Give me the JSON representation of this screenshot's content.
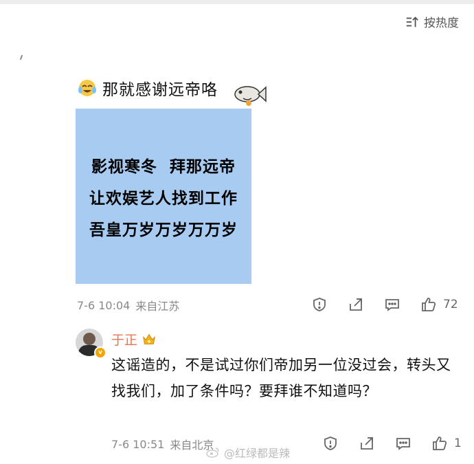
{
  "sort": {
    "label": "按热度",
    "icon": "sort-icon"
  },
  "comment": {
    "caption": "那就感谢远帝咯",
    "caption_emoji": "crying-laugh-emoji",
    "sticker": "fish-sticker",
    "meme_lines": [
      "影视寒冬  拜那远帝",
      "让欢娱艺人找到工作",
      "吾皇万岁万岁万万岁"
    ],
    "meme_bg": "#a7cbf1",
    "timestamp": "7-6 10:04",
    "location": "来自江苏",
    "likes": "72"
  },
  "reply": {
    "username": "于正",
    "name_color": "#eb7350",
    "badge": "crown-icon",
    "verified_badge": "v",
    "text": "这谣造的，不是试过你们帝加另一位没过会，转头又找我们，加了条件吗？要拜谁不知道吗？",
    "timestamp": "7-6 10:51",
    "location": "来自北京",
    "likes": "1"
  },
  "watermark": {
    "text": "@红绿都是辣",
    "icon": "weibo-icon"
  }
}
